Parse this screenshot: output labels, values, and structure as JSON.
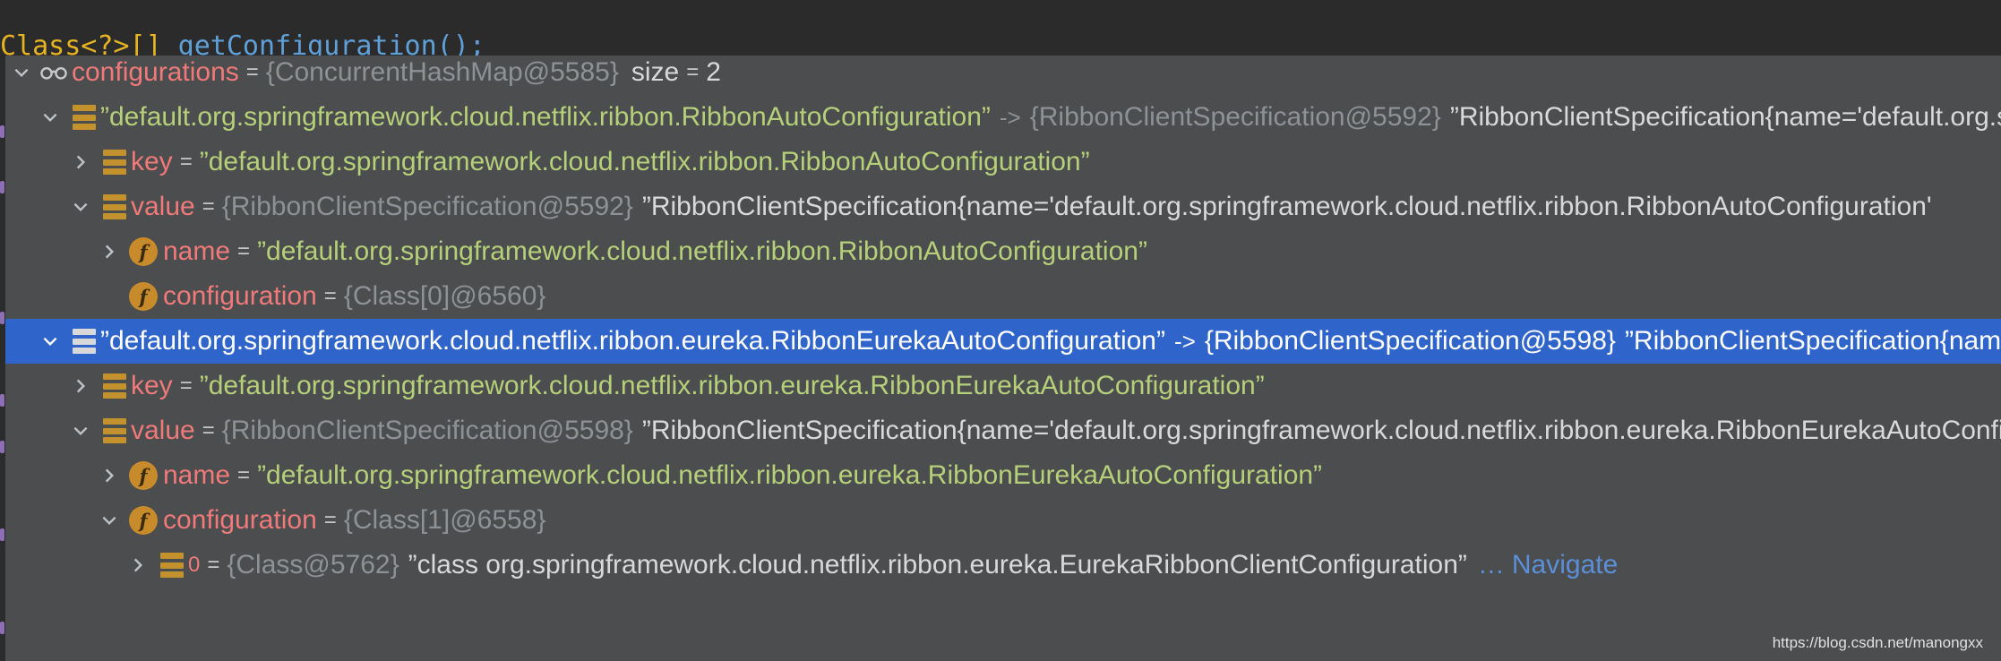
{
  "editor": {
    "code_prefix": "Class<?>[] ",
    "code_method": "getConfiguration();"
  },
  "tree": {
    "rows": [
      {
        "name": "configurations",
        "eq": "=",
        "ref": "{ConcurrentHashMap@5585}",
        "size_label": "size",
        "size_eq": "=",
        "size_value": "2"
      },
      {
        "string": "”default.org.springframework.cloud.netflix.ribbon.RibbonAutoConfiguration”",
        "arrow": "->",
        "ref": "{RibbonClientSpecification@5592}",
        "trail": "”RibbonClientSpecification{name='default.org.springframework.cloud.netflix.ribbon.RibbonAutoConfiguration'"
      },
      {
        "name": "key",
        "eq": "=",
        "string": "”default.org.springframework.cloud.netflix.ribbon.RibbonAutoConfiguration”"
      },
      {
        "name": "value",
        "eq": "=",
        "ref": "{RibbonClientSpecification@5592}",
        "trail": "”RibbonClientSpecification{name='default.org.springframework.cloud.netflix.ribbon.RibbonAutoConfiguration'"
      },
      {
        "name": "name",
        "eq": "=",
        "string": "”default.org.springframework.cloud.netflix.ribbon.RibbonAutoConfiguration”"
      },
      {
        "name": "configuration",
        "eq": "=",
        "ref": "{Class[0]@6560}"
      },
      {
        "string": "”default.org.springframework.cloud.netflix.ribbon.eureka.RibbonEurekaAutoConfiguration”",
        "arrow": "->",
        "ref": "{RibbonClientSpecification@5598}",
        "trail": "”RibbonClientSpecification{name='default.org.springframework.cloud.netflix.ribbon.eureka.RibbonEurekaAutoConfiguration'"
      },
      {
        "name": "key",
        "eq": "=",
        "string": "”default.org.springframework.cloud.netflix.ribbon.eureka.RibbonEurekaAutoConfiguration”"
      },
      {
        "name": "value",
        "eq": "=",
        "ref": "{RibbonClientSpecification@5598}",
        "trail": "”RibbonClientSpecification{name='default.org.springframework.cloud.netflix.ribbon.eureka.RibbonEurekaAutoConfiguration'"
      },
      {
        "name": "name",
        "eq": "=",
        "string": "”default.org.springframework.cloud.netflix.ribbon.eureka.RibbonEurekaAutoConfiguration”"
      },
      {
        "name": "configuration",
        "eq": "=",
        "ref": "{Class[1]@6558}"
      },
      {
        "name": "0",
        "eq": "=",
        "ref": "{Class@5762}",
        "trail": "”class org.springframework.cloud.netflix.ribbon.eureka.EurekaRibbonClientConfiguration”",
        "ellipsis": "…",
        "nav": "Navigate"
      }
    ]
  },
  "icons": {
    "watch": "glasses-icon",
    "entry": "map-entry-icon",
    "field": "field-icon",
    "field_letter": "f",
    "expanded": "chevron-down-icon",
    "collapsed": "chevron-right-icon"
  },
  "colors": {
    "popup_bg": "#4b4d4e",
    "selected_row": "#2f65ca",
    "string": "#b6d07a",
    "name": "#f07a7a",
    "link": "#5b8fd8"
  },
  "watermark": "https://blog.csdn.net/manongxx"
}
